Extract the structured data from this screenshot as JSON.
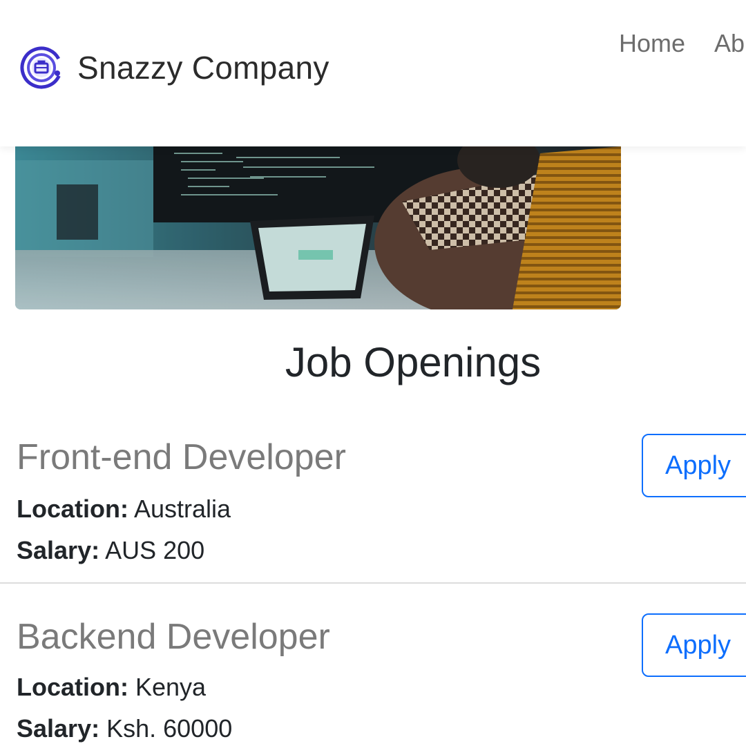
{
  "brand": {
    "name": "Snazzy Company",
    "logo_icon": "briefcase-gear-icon",
    "logo_color": "#3b2ec9"
  },
  "nav": {
    "links": [
      "Home",
      "Ab"
    ]
  },
  "hero": {
    "image_icon": "developer-workspace-photo"
  },
  "section": {
    "title": "Job Openings"
  },
  "jobs": [
    {
      "title": "Front-end Developer",
      "location_label": "Location:",
      "location": "Australia",
      "salary_label": "Salary:",
      "salary": "AUS 200",
      "apply_label": "Apply"
    },
    {
      "title": "Backend Developer",
      "location_label": "Location:",
      "location": "Kenya",
      "salary_label": "Salary:",
      "salary": "Ksh. 60000",
      "apply_label": "Apply"
    }
  ],
  "colors": {
    "accent": "#0d6efd",
    "job_title": "#7a7a7a",
    "text": "#212529"
  }
}
